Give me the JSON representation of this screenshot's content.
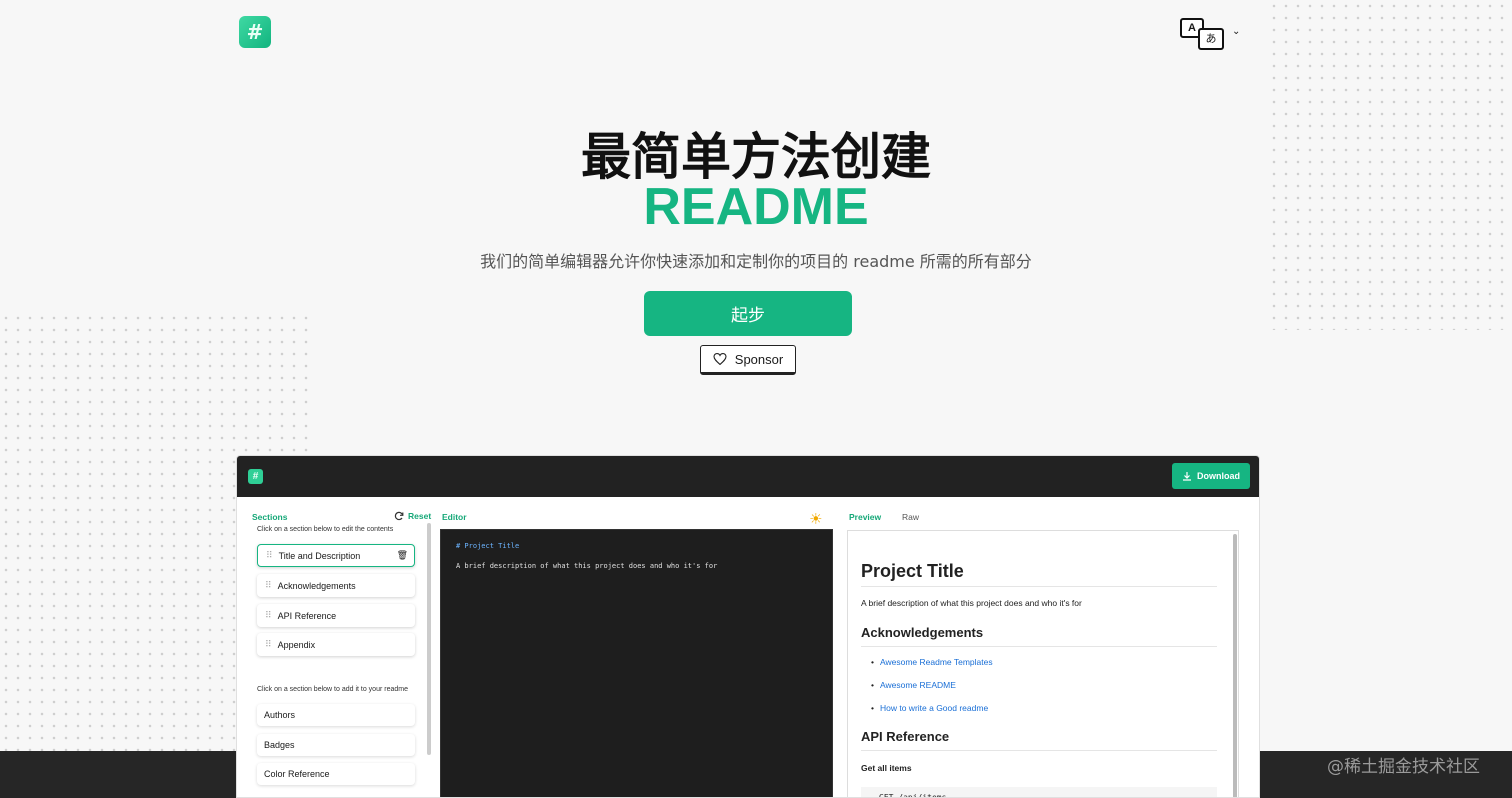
{
  "header": {
    "logo_glyph": "#",
    "lang_icon_a": "A",
    "lang_icon_b": "あ",
    "lang_chevron": "⌄"
  },
  "hero": {
    "title_line1": "最简单方法创建",
    "title_line2": "README",
    "subtitle": "我们的简单编辑器允许你快速添加和定制你的项目的 readme 所需的所有部分",
    "start_label": "起步",
    "sponsor_label": "Sponsor"
  },
  "app": {
    "logo_glyph": "#",
    "download_label": "Download",
    "sections_label": "Sections",
    "reset_label": "Reset",
    "edit_hint": "Click on a section below to edit the contents",
    "sections": [
      {
        "label": "Title and Description"
      },
      {
        "label": "Acknowledgements"
      },
      {
        "label": "API Reference"
      },
      {
        "label": "Appendix"
      }
    ],
    "add_hint": "Click on a section below to add it to your readme",
    "add_sections": [
      {
        "label": "Authors"
      },
      {
        "label": "Badges"
      },
      {
        "label": "Color Reference"
      }
    ],
    "editor_label": "Editor",
    "editor_lines": [
      "# Project Title",
      "A brief description of what this project does and who it's for"
    ],
    "preview_tab": "Preview",
    "raw_tab": "Raw",
    "preview": {
      "h1": "Project Title",
      "desc": "A brief description of what this project does and who it's for",
      "h2_ack": "Acknowledgements",
      "links": [
        "Awesome Readme Templates",
        "Awesome README",
        "How to write a Good readme"
      ],
      "h2_api": "API Reference",
      "h4": "Get all items",
      "code": "GET /api/items"
    }
  },
  "watermark": "@稀土掘金技术社区",
  "colors": {
    "accent": "#16b582",
    "dark": "#222222",
    "link": "#1a6fd6"
  }
}
